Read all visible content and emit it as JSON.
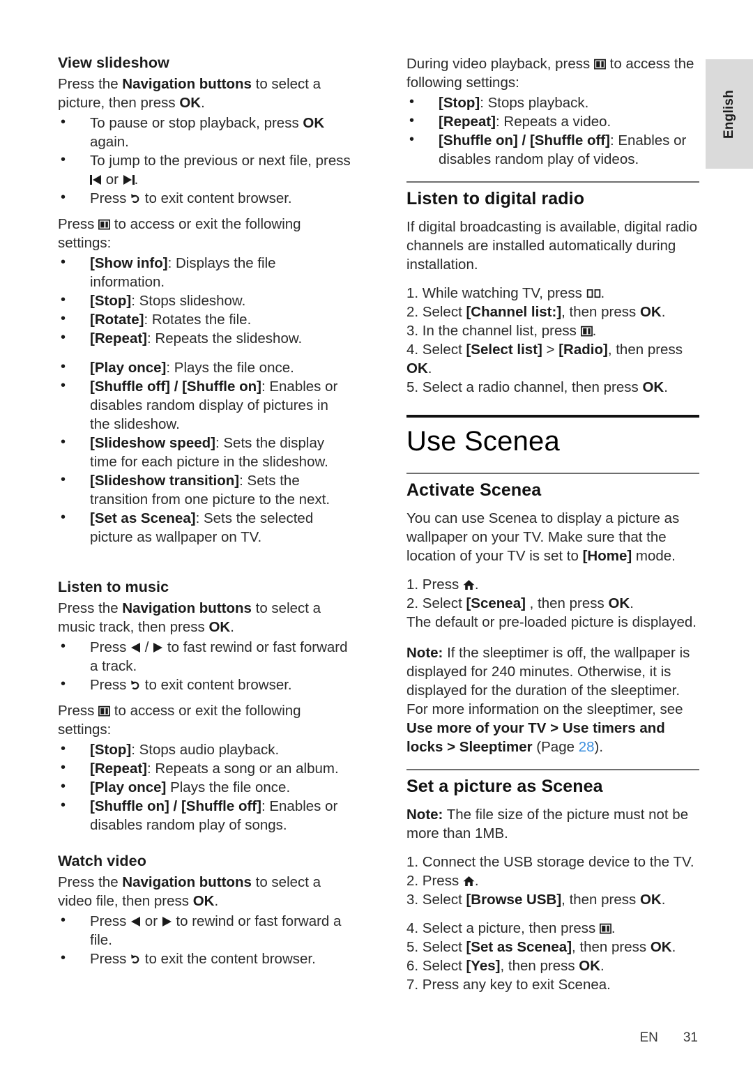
{
  "page": {
    "language_tab": "English",
    "footer": {
      "lang_code": "EN",
      "page_number": "31"
    }
  },
  "left_column": {
    "view_slideshow": {
      "heading": "View slideshow",
      "intro_1": "Press the ",
      "intro_bold": "Navigation buttons",
      "intro_2": " to select a picture, then press ",
      "intro_bold2": "OK",
      "intro_3": ".",
      "bullets": [
        {
          "pre": "To pause or stop playback, press ",
          "bold": "OK",
          "post": " again."
        },
        {
          "pre": "To jump to the previous or next file, press ",
          "icon1": "previous-track-icon",
          "mid": " or ",
          "icon2": "next-track-icon",
          "post": "."
        },
        {
          "pre": "Press ",
          "icon1": "back-icon",
          "post": " to exit content browser."
        }
      ],
      "settings_intro_1": "Press ",
      "settings_icon": "options-icon",
      "settings_intro_2": " to access or exit the following settings:",
      "settings": [
        {
          "bold": "[Show info]",
          "text": ": Displays the file information."
        },
        {
          "bold": "[Stop]",
          "text": ": Stops slideshow."
        },
        {
          "bold": "[Rotate]",
          "text": ": Rotates the file."
        },
        {
          "bold": "[Repeat]",
          "text": ": Repeats the slideshow."
        },
        {
          "bold": "[Play once]",
          "text": ": Plays the file once."
        },
        {
          "bold": "[Shuffle off] / [Shuffle on]",
          "text": ": Enables or disables random display of pictures in the slideshow."
        },
        {
          "bold": "[Slideshow speed]",
          "text": ": Sets the display time for each picture in the slideshow."
        },
        {
          "bold": "[Slideshow transition]",
          "text": ": Sets the transition from one picture to the next."
        },
        {
          "bold": "[Set as Scenea]",
          "text": ": Sets the selected picture as wallpaper on TV."
        }
      ]
    },
    "listen_to_music": {
      "heading": "Listen to music",
      "intro_1": "Press the ",
      "intro_bold": "Navigation buttons",
      "intro_2": " to select a music track, then press ",
      "intro_bold2": "OK",
      "intro_3": ".",
      "bullets": [
        {
          "pre": "Press ",
          "icon1": "rewind-icon",
          "mid": " / ",
          "icon2": "fast-forward-icon",
          "post": " to fast rewind or fast forward a track."
        },
        {
          "pre": "Press ",
          "icon1": "back-icon",
          "post": " to exit content browser."
        }
      ],
      "settings_intro_1": "Press ",
      "settings_icon": "options-icon",
      "settings_intro_2": " to access or exit the following settings:",
      "settings": [
        {
          "bold": "[Stop]",
          "text": ": Stops audio playback."
        },
        {
          "bold": "[Repeat]",
          "text": ": Repeats a song or an album."
        },
        {
          "bold": "[Play once]",
          "text": " Plays the file once."
        },
        {
          "bold": "[Shuffle on] / [Shuffle off]",
          "text": ": Enables or disables random play of songs."
        }
      ]
    },
    "watch_video": {
      "heading": "Watch video",
      "intro_1": "Press the ",
      "intro_bold": "Navigation buttons",
      "intro_2": " to select a video file, then press ",
      "intro_bold2": "OK",
      "intro_3": ".",
      "bullets": [
        {
          "pre": "Press ",
          "icon1": "rewind-icon",
          "mid": " or ",
          "icon2": "fast-forward-icon",
          "post": " to rewind or fast forward a file."
        },
        {
          "pre": "Press ",
          "icon1": "back-icon",
          "post": " to exit the content browser."
        }
      ]
    }
  },
  "right_column": {
    "video_playback_settings": {
      "intro_1": "During video playback, press ",
      "intro_icon": "options-icon",
      "intro_2": " to access the following settings:",
      "settings": [
        {
          "bold": "[Stop]",
          "text": ": Stops playback."
        },
        {
          "bold": "[Repeat]",
          "text": ": Repeats a video."
        },
        {
          "bold": "[Shuffle on] / [Shuffle off]",
          "text": ": Enables or disables random play of videos."
        }
      ]
    },
    "listen_digital_radio": {
      "heading": "Listen to digital radio",
      "para": "If digital broadcasting is available, digital radio channels are installed automatically during installation.",
      "steps": [
        {
          "num": "1.",
          "pre": " While watching TV, press ",
          "icon": "book-icon",
          "post": "."
        },
        {
          "num": "2.",
          "pre": " Select ",
          "bold": "[Channel list:]",
          "post": ", then press ",
          "bold2": "OK",
          "tail": "."
        },
        {
          "num": "3.",
          "pre": " In the channel list, press ",
          "icon": "options-icon",
          "post": "."
        },
        {
          "num": "4.",
          "pre": " Select ",
          "bold": "[Select list]",
          "mid": " > ",
          "bold2": "[Radio]",
          "post": ", then press ",
          "bold3": "OK",
          "tail": "."
        },
        {
          "num": "5.",
          "pre": " Select a radio channel, then press ",
          "bold": "OK",
          "tail": "."
        }
      ]
    },
    "use_scenea": {
      "chapter_heading": "Use Scenea",
      "activate": {
        "heading": "Activate Scenea",
        "para_1": "You can use Scenea to display a picture as wallpaper on your TV. Make sure that the location of your TV is set to ",
        "para_bold": "[Home]",
        "para_2": " mode.",
        "steps": [
          {
            "num": "1.",
            "pre": " Press ",
            "icon": "home-icon",
            "post": "."
          },
          {
            "num": "2.",
            "pre": " Select ",
            "bold": "[Scenea]",
            "post": " , then press ",
            "bold2": "OK",
            "tail": "."
          }
        ],
        "step_note": "The default or pre-loaded picture is displayed.",
        "note": {
          "label": "Note:",
          "text_1": " If the sleeptimer is off, the wallpaper is displayed for 240 minutes. Otherwise, it is displayed for the duration of the sleeptimer. For more information on the sleeptimer, see ",
          "crossref": "Use more of your TV > Use timers and locks > Sleeptimer",
          "text_2": " (Page ",
          "page_link": "28",
          "text_3": ")."
        }
      },
      "set_picture": {
        "heading": "Set a picture as Scenea",
        "note": {
          "label": "Note:",
          "text": " The file size of the picture must not be more than 1MB."
        },
        "steps": [
          {
            "num": "1.",
            "pre": " Connect the USB storage device to the TV."
          },
          {
            "num": "2.",
            "pre": " Press ",
            "icon": "home-icon",
            "post": "."
          },
          {
            "num": "3.",
            "pre": " Select ",
            "bold": "[Browse USB]",
            "post": ", then press ",
            "bold2": "OK",
            "tail": "."
          },
          {
            "num": "4.",
            "pre": " Select a picture, then press ",
            "icon": "options-icon",
            "post": "."
          },
          {
            "num": "5.",
            "pre": " Select ",
            "bold": "[Set as Scenea]",
            "post": ", then press ",
            "bold2": "OK",
            "tail": "."
          },
          {
            "num": "6.",
            "pre": " Select ",
            "bold": "[Yes]",
            "post": ", then press ",
            "bold2": "OK",
            "tail": "."
          },
          {
            "num": "7.",
            "pre": " Press any key to exit Scenea."
          }
        ]
      }
    }
  },
  "colors": {
    "body_text": "#2b2b2b",
    "bold_text": "#1b1b1b",
    "link": "#3a8ede",
    "tab_background": "#dadada",
    "rule": "#6e6e6e",
    "rule_thick": "#111111"
  }
}
